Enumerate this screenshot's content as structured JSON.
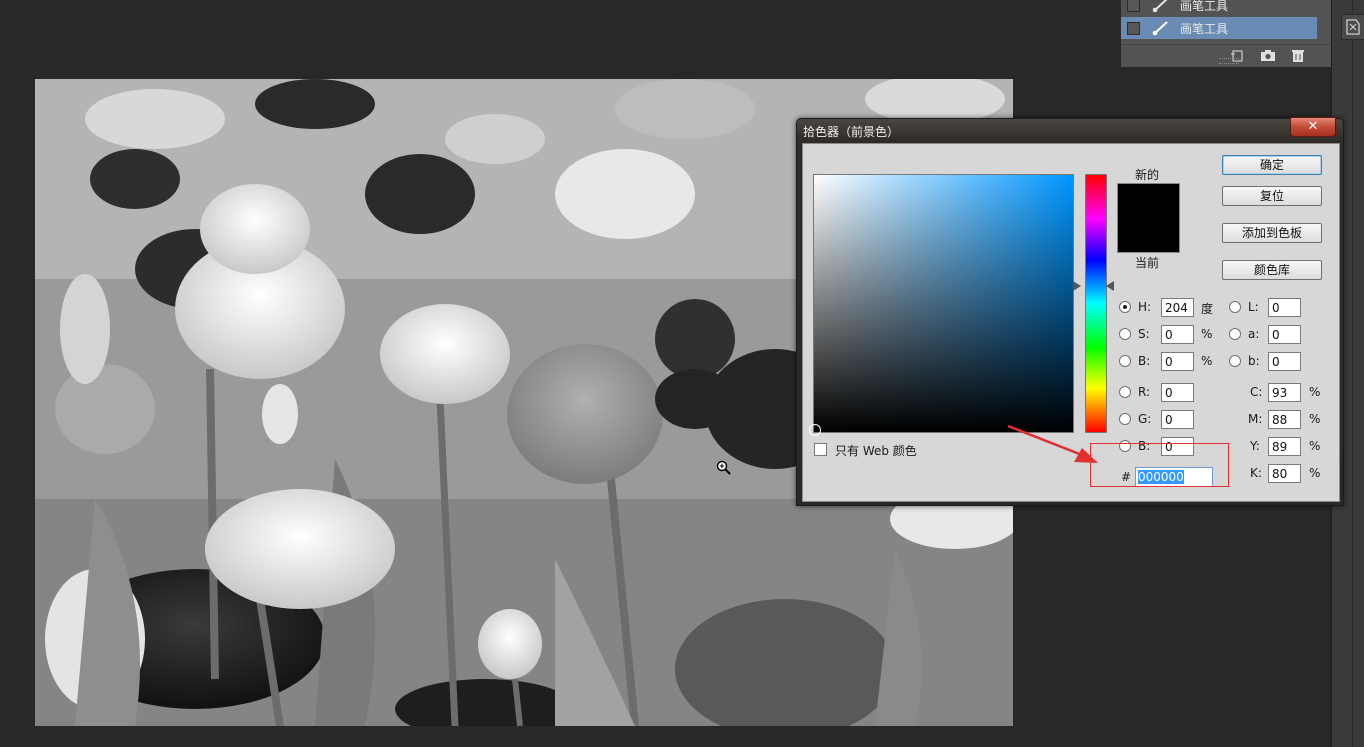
{
  "history_panel": {
    "items": [
      {
        "label": "画笔工具",
        "selected": false
      },
      {
        "label": "画笔工具",
        "selected": true
      }
    ],
    "toolbar_icons": [
      "new-snapshot-icon",
      "camera-icon",
      "trash-icon"
    ]
  },
  "color_picker": {
    "title": "拾色器（前景色）",
    "close_glyph": "✕",
    "new_label": "新的",
    "current_label": "当前",
    "new_color": "#000000",
    "current_color": "#000000",
    "buttons": {
      "ok": "确定",
      "reset": "复位",
      "add_to_swatches": "添加到色板",
      "color_libraries": "颜色库"
    },
    "hsb": {
      "h_label": "H:",
      "h_value": "204",
      "h_unit": "度",
      "s_label": "S:",
      "s_value": "0",
      "s_unit": "%",
      "b_label": "B:",
      "b_value": "0",
      "b_unit": "%",
      "selected": "H"
    },
    "rgb": {
      "r_label": "R:",
      "r_value": "0",
      "g_label": "G:",
      "g_value": "0",
      "b_label": "B:",
      "b_value": "0"
    },
    "lab": {
      "l_label": "L:",
      "l_value": "0",
      "a_label": "a:",
      "a_value": "0",
      "b_label": "b:",
      "b_value": "0"
    },
    "cmyk": {
      "c_label": "C:",
      "c_value": "93",
      "m_label": "M:",
      "m_value": "88",
      "y_label": "Y:",
      "y_value": "89",
      "k_label": "K:",
      "k_value": "80",
      "unit": "%"
    },
    "web_only_label": "只有 Web 颜色",
    "web_only_checked": false,
    "hex_label": "#",
    "hex_value": "000000",
    "field_color": "#0096ff"
  },
  "annotation_color": "#e03030"
}
